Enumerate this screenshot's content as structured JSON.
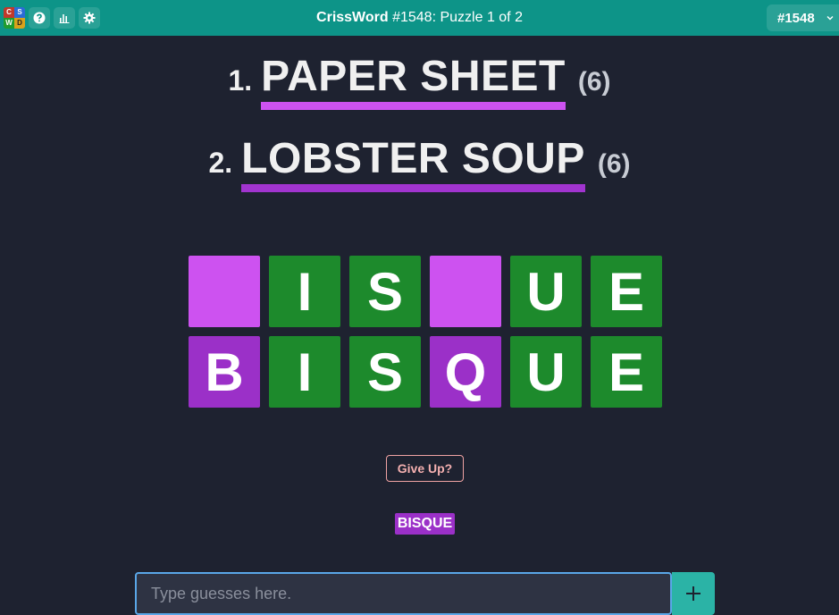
{
  "header": {
    "logo_letters": [
      "C",
      "S",
      "W",
      "D"
    ],
    "app_name": "CrissWord",
    "puzzle_title": " #1548: Puzzle 1 of 2",
    "puzzle_select": "#1548",
    "icons": [
      "help-icon",
      "stats-icon",
      "gear-icon",
      "chevron-down-icon"
    ]
  },
  "clues": [
    {
      "number": "1.",
      "text": "PAPER SHEET",
      "length": "(6)",
      "underline_color": "#cd52f0"
    },
    {
      "number": "2.",
      "text": "LOBSTER SOUP",
      "length": "(6)",
      "underline_color": "#a134cf"
    }
  ],
  "grid": {
    "colors": {
      "green": "#1d8a2c",
      "pink": "#cd52f0",
      "purple": "#9b30c8"
    },
    "rows": [
      [
        {
          "letter": "",
          "color": "pink"
        },
        {
          "letter": "I",
          "color": "green"
        },
        {
          "letter": "S",
          "color": "green"
        },
        {
          "letter": "",
          "color": "pink"
        },
        {
          "letter": "U",
          "color": "green"
        },
        {
          "letter": "E",
          "color": "green"
        }
      ],
      [
        {
          "letter": "B",
          "color": "purple"
        },
        {
          "letter": "I",
          "color": "green"
        },
        {
          "letter": "S",
          "color": "green"
        },
        {
          "letter": "Q",
          "color": "purple"
        },
        {
          "letter": "U",
          "color": "green"
        },
        {
          "letter": "E",
          "color": "green"
        }
      ]
    ]
  },
  "give_up_label": "Give Up?",
  "guessed_words": [
    "BISQUE"
  ],
  "guess_input": {
    "value": "",
    "placeholder": "Type guesses here."
  }
}
